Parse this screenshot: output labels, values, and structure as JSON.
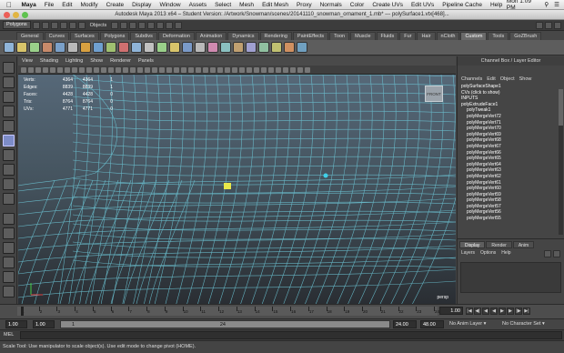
{
  "mac_menu": {
    "app": "Maya",
    "items": [
      "File",
      "Edit",
      "Modify",
      "Create",
      "Display",
      "Window",
      "Assets",
      "Select",
      "Mesh",
      "Edit Mesh",
      "Proxy",
      "Normals",
      "Color",
      "Create UVs",
      "Edit UVs",
      "Pipeline Cache",
      "Help"
    ],
    "clock": "Mon 1:09 PM"
  },
  "window": {
    "title": "Autodesk Maya 2013 x64 – Student Version: /Artwork/Snowman/scenes/20141110_snowman_ornament_1.mb* --- polySurface1.vtx[468]..."
  },
  "status_line": {
    "menu_set": "Polygons",
    "objects_label": "Objects"
  },
  "shelf": {
    "tabs": [
      "General",
      "Curves",
      "Surfaces",
      "Polygons",
      "Subdivs",
      "Deformation",
      "Animation",
      "Dynamics",
      "Rendering",
      "PaintEffects",
      "Toon",
      "Muscle",
      "Fluids",
      "Fur",
      "Hair",
      "nCloth",
      "Custom",
      "Tools",
      "GoZBrush"
    ],
    "active_tab": "Custom",
    "icon_colors": [
      "#8fb4d8",
      "#d8c46a",
      "#9ad08a",
      "#c78a6a",
      "#7aa0c8",
      "#b9b9b9",
      "#d8a040",
      "#6fa0d0",
      "#a0c070",
      "#d07070",
      "#8fb4d8",
      "#c0c0c0",
      "#9ad08a",
      "#d8c46a",
      "#7a9ac8",
      "#b9b9b9",
      "#d08ab0",
      "#8ac0c0",
      "#c0a070",
      "#a0a0d0",
      "#90c0a0",
      "#c0c070",
      "#d09060",
      "#70a0c0"
    ]
  },
  "viewport": {
    "menu": [
      "View",
      "Shading",
      "Lighting",
      "Show",
      "Renderer",
      "Panels"
    ],
    "hud": [
      {
        "label": "Verts:",
        "a": "4364",
        "b": "4364",
        "c": "1"
      },
      {
        "label": "Edges:",
        "a": "8839",
        "b": "8839",
        "c": "1"
      },
      {
        "label": "Faces:",
        "a": "4428",
        "b": "4428",
        "c": "0"
      },
      {
        "label": "Tris:",
        "a": "8764",
        "b": "8764",
        "c": "0"
      },
      {
        "label": "UVs:",
        "a": "4771",
        "b": "4771",
        "c": "0"
      }
    ],
    "viewcube_label": "FRONT",
    "camera_label": "persp"
  },
  "channel_box": {
    "title": "Channel Box / Layer Editor",
    "menu": [
      "Channels",
      "Edit",
      "Object",
      "Show"
    ],
    "shape": "polySurfaceShape1",
    "items": [
      "CVs (click to show)",
      "INPUTS",
      "polyExtrudeFace1",
      "polyTweak1",
      "polyMergeVert72",
      "polyMergeVert71",
      "polyMergeVert70",
      "polyMergeVert69",
      "polyMergeVert68",
      "polyMergeVert67",
      "polyMergeVert66",
      "polyMergeVert65",
      "polyMergeVert64",
      "polyMergeVert63",
      "polyMergeVert62",
      "polyMergeVert61",
      "polyMergeVert60",
      "polyMergeVert59",
      "polyMergeVert58",
      "polyMergeVert57",
      "polyMergeVert56",
      "polyMergeVert55"
    ]
  },
  "layer_editor": {
    "tabs": [
      "Display",
      "Render",
      "Anim"
    ],
    "active_tab": "Display",
    "menu": [
      "Layers",
      "Options",
      "Help"
    ]
  },
  "timeline": {
    "current_frame": "1.00",
    "ticks": [
      "1",
      "2",
      "3",
      "4",
      "5",
      "6",
      "7",
      "8",
      "9",
      "10",
      "11",
      "12",
      "13",
      "14",
      "15",
      "16",
      "17",
      "18",
      "19",
      "20",
      "21",
      "22",
      "23",
      "24"
    ]
  },
  "range": {
    "start": "1.00",
    "playback_start": "1.00",
    "slider_start": "1",
    "slider_end": "24",
    "playback_end": "24.00",
    "end": "48.00",
    "anim_layer": "No Anim Layer",
    "char_set": "No Character Set"
  },
  "command_line": {
    "label": "MEL"
  },
  "help_line": "Scale Tool: Use manipulator to scale object(s). Use edit mode to change pivot (HOME)."
}
